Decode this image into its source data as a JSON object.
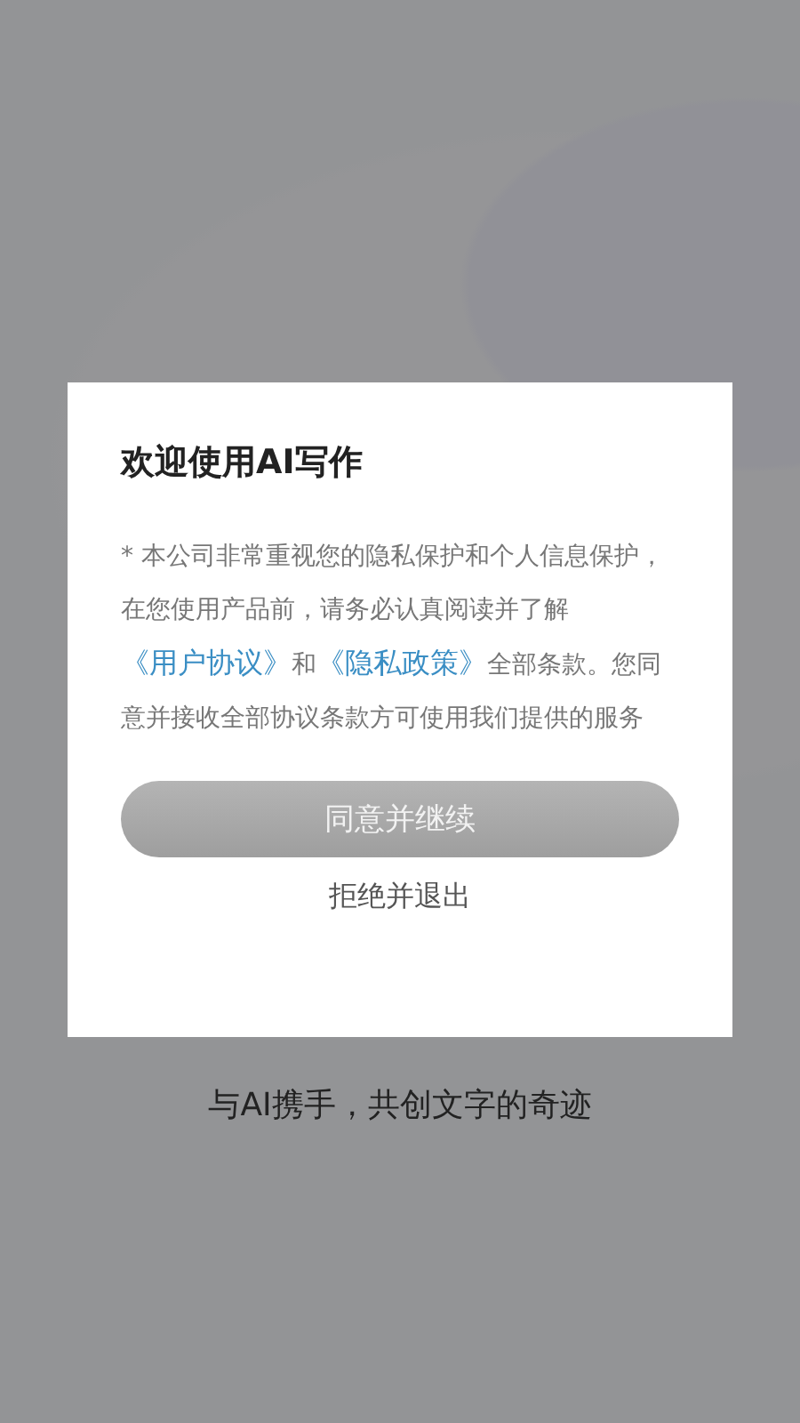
{
  "dialog": {
    "title": "欢迎使用AI写作",
    "notice": [
      {
        "kind": "text",
        "text": "* 本公司非常重视您的隐私保护和个人信息保护，在您使用产品前，请务必认真阅读并了解"
      },
      {
        "kind": "link",
        "text": "《用户协议》"
      },
      {
        "kind": "text",
        "text": "和"
      },
      {
        "kind": "link",
        "text": "《隐私政策》"
      },
      {
        "kind": "text",
        "text": "全部条款。您同意并接收全部协议条款方可使用我们提供的服务"
      }
    ],
    "agree_button": {
      "label": "同意并继续",
      "disabled": true
    },
    "decline_link": {
      "label": "拒绝并退出"
    }
  },
  "tagline": "与AI携手，共创文字的奇迹"
}
